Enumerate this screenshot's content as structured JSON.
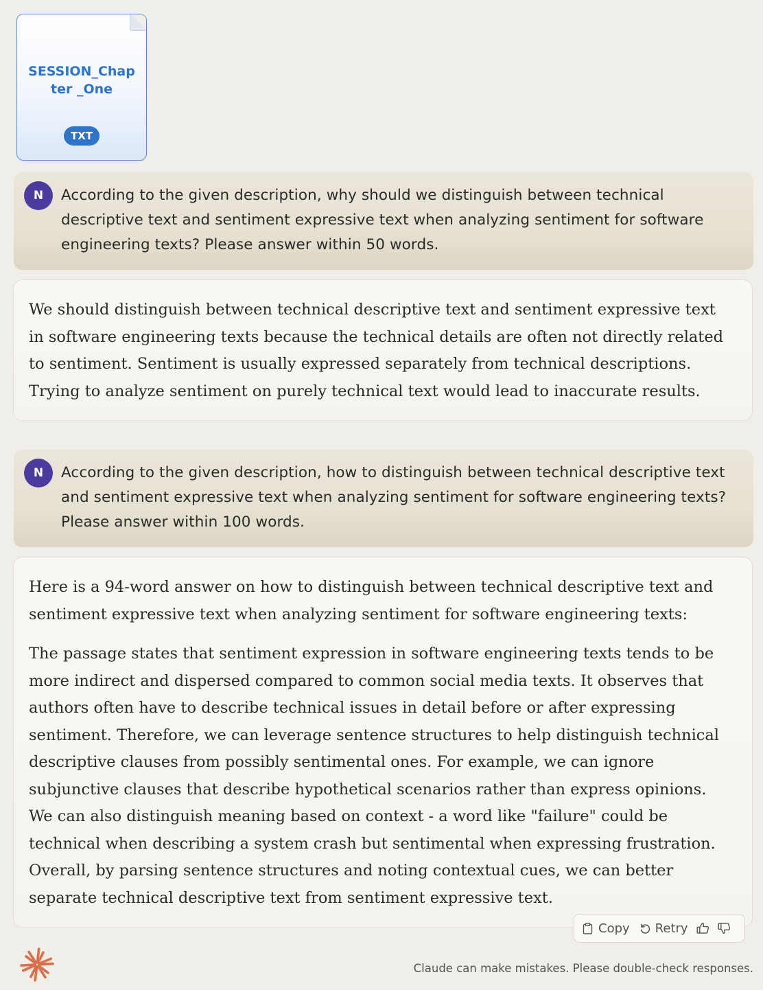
{
  "attachment": {
    "filename": "SESSION_Chapter _One",
    "type_badge": "TXT"
  },
  "messages": [
    {
      "role": "user",
      "avatar_initial": "N",
      "text": "According to the given description, why should we distinguish between technical descriptive text and sentiment expressive text when analyzing sentiment for software engineering texts? Please answer within 50 words."
    },
    {
      "role": "assistant",
      "paragraphs": [
        "We should distinguish between technical descriptive text and sentiment expressive text in software engineering texts because the technical details are often not directly related to sentiment. Sentiment is usually expressed separately from technical descriptions. Trying to analyze sentiment on purely technical text would lead to inaccurate results."
      ]
    },
    {
      "role": "user",
      "avatar_initial": "N",
      "text": "According to the given description, how to distinguish between technical descriptive text and sentiment expressive text when analyzing sentiment for software engineering texts? Please answer within 100 words."
    },
    {
      "role": "assistant",
      "paragraphs": [
        "Here is a 94-word answer on how to distinguish between technical descriptive text and sentiment expressive text when analyzing sentiment for software engineering texts:",
        "The passage states that sentiment expression in software engineering texts tends to be more indirect and dispersed compared to common social media texts. It observes that authors often have to describe technical issues in detail before or after expressing sentiment. Therefore, we can leverage sentence structures to help distinguish technical descriptive clauses from possibly sentimental ones. For example, we can ignore subjunctive clauses that describe hypothetical scenarios rather than express opinions. We can also distinguish meaning based on context - a word like \"failure\" could be technical when describing a system crash but sentimental when expressing frustration. Overall, by parsing sentence structures and noting contextual cues, we can better separate technical descriptive text from sentiment expressive text."
      ]
    }
  ],
  "actions": {
    "copy_label": "Copy",
    "retry_label": "Retry",
    "copy_icon": "clipboard-icon",
    "retry_icon": "retry-icon",
    "thumbs_up_icon": "thumbs-up-icon",
    "thumbs_down_icon": "thumbs-down-icon"
  },
  "footer": {
    "disclaimer": "Claude can make mistakes. Please double-check responses.",
    "logo_icon": "claude-logo-icon"
  },
  "colors": {
    "background": "#f0eee8",
    "avatar": "#4b3aa0",
    "attachment_accent": "#2f74c9",
    "logo": "#d9704a"
  }
}
